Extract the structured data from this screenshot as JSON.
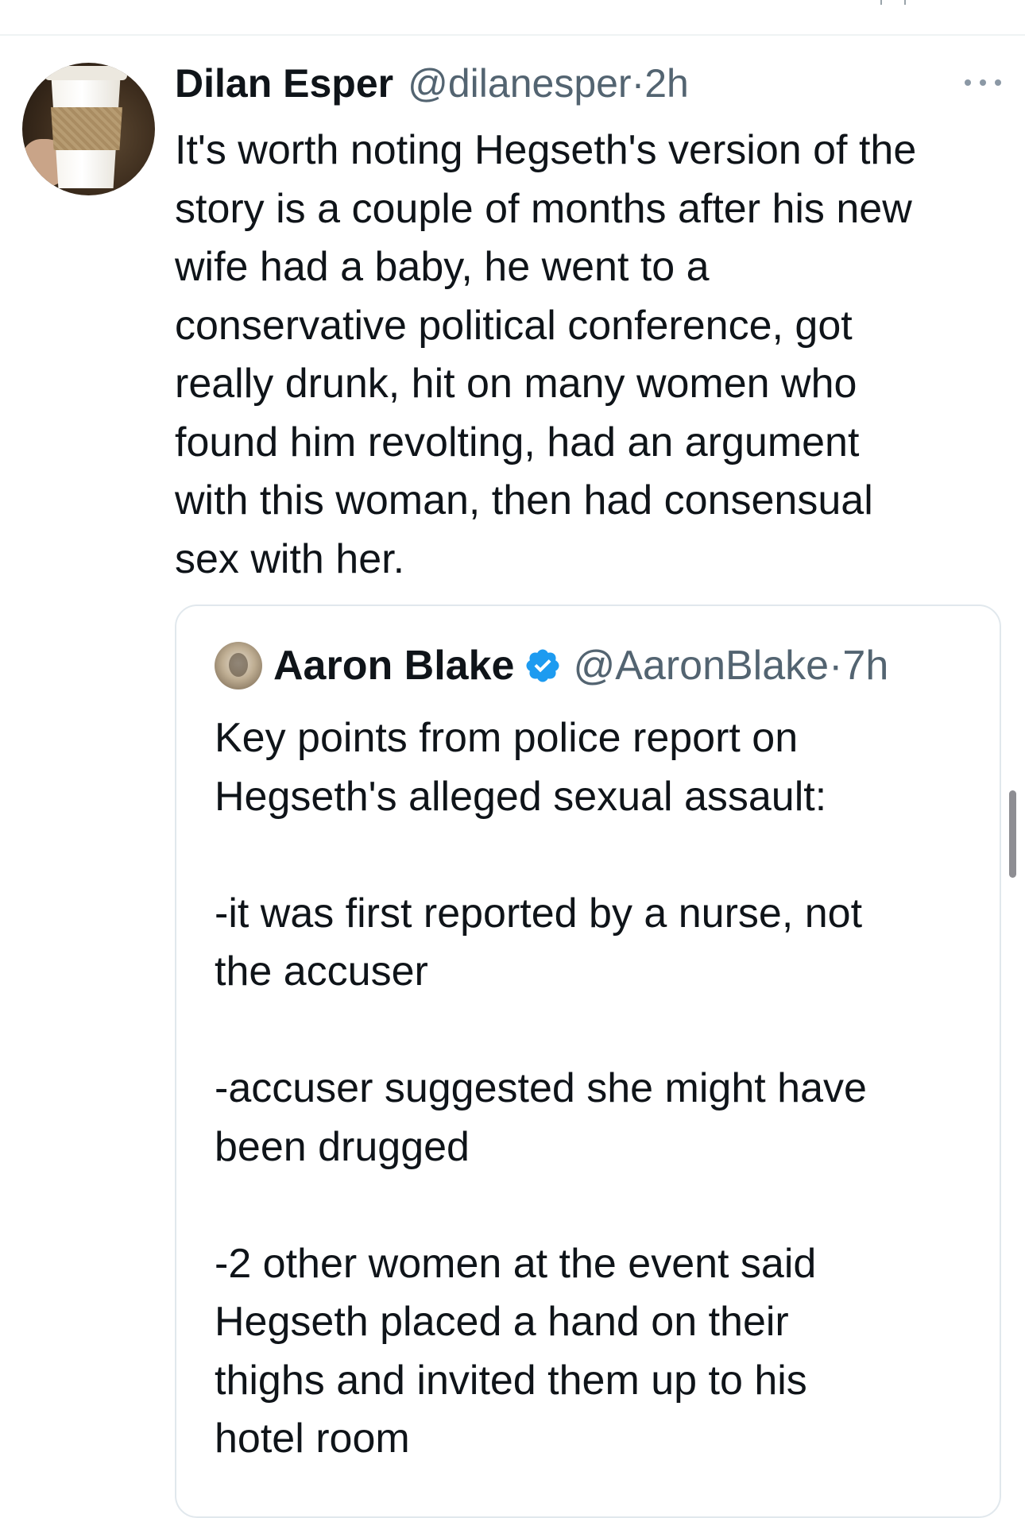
{
  "tweet": {
    "author_name": "Dilan Esper",
    "author_meta": "@dilanesper·2h",
    "text": "It's worth noting Hegseth's version of the\nstory is a couple of months after his new\nwife had a baby, he went to a\nconservative political conference, got\nreally drunk, hit on many women who\nfound him revolting, had an argument\nwith this woman, then had consensual\nsex with her."
  },
  "quoted_tweet": {
    "author_name": "Aaron Blake",
    "author_meta": "@AaronBlake·7h",
    "text": "Key points from police report on\nHegseth's alleged sexual assault:\n\n-it was first reported by a nurse, not\nthe accuser\n\n-accuser suggested she might have\nbeen drugged\n\n-2 other women at the event said\nHegseth placed a hand on their\nthighs and invited them up to his\nhotel room"
  },
  "icons": {
    "more": "more-horizontal-icon",
    "verified": "verified-badge-icon"
  },
  "colors": {
    "text_primary": "#0f1419",
    "text_secondary": "#536471",
    "verified_blue": "#1d9bf0",
    "border": "#e1e8ed"
  }
}
